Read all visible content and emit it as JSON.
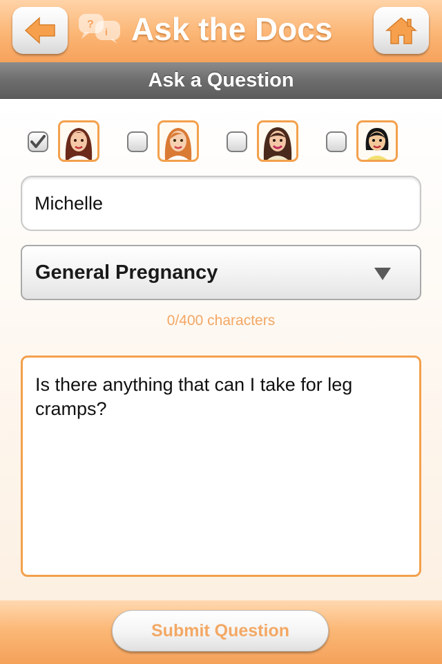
{
  "header": {
    "title": "Ask the Docs",
    "back_icon": "arrow-left-icon",
    "home_icon": "home-icon",
    "chat_icon": "chat-bubbles-icon"
  },
  "subheader": {
    "title": "Ask a Question"
  },
  "doctors": [
    {
      "checked": true,
      "icon": "doctor-avatar-1"
    },
    {
      "checked": false,
      "icon": "doctor-avatar-2"
    },
    {
      "checked": false,
      "icon": "doctor-avatar-3"
    },
    {
      "checked": false,
      "icon": "doctor-avatar-4"
    }
  ],
  "form": {
    "name_value": "Michelle",
    "category_selected": "General Pregnancy",
    "char_count": "0/400 characters",
    "question_text": "Is there anything that can I take for leg cramps?"
  },
  "footer": {
    "submit_label": "Submit Question"
  },
  "colors": {
    "accent": "#f6a25c",
    "accent_border": "#f3a04c",
    "accent_text": "#f3a865",
    "subbar": "#6d6d6d"
  }
}
